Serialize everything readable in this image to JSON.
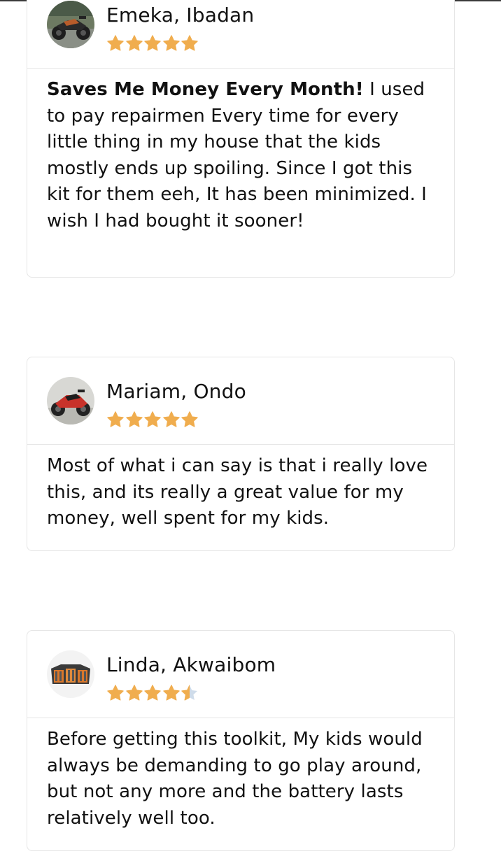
{
  "reviews": [
    {
      "name": "Emeka, Ibadan",
      "rating": 5,
      "avatar_icon": "motorcycle-photo-icon",
      "headline": "Saves Me Money Every Month!",
      "text": " I used to pay repairmen Every time for every little thing in my house that the kids mostly ends up spoiling. Since I got this kit for them eeh, It has been minimized. I wish I had bought it sooner!"
    },
    {
      "name": "Mariam, Ondo",
      "rating": 5,
      "avatar_icon": "motorcycle-photo-icon",
      "headline": "",
      "text": "Most of what i can say is that i really love this, and its really a great value for my money, well spent for my kids."
    },
    {
      "name": "Linda, Akwaibom",
      "rating": 4.5,
      "avatar_icon": "toolbox-photo-icon",
      "headline": "",
      "text": "Before getting this toolkit, My kids would always be demanding to go play around, but not any more and the battery lasts relatively well too."
    }
  ],
  "colors": {
    "star_filled": "#f0ad4e",
    "star_empty": "#cfdcea",
    "card_border": "#e6e6e6",
    "text": "#111111"
  }
}
